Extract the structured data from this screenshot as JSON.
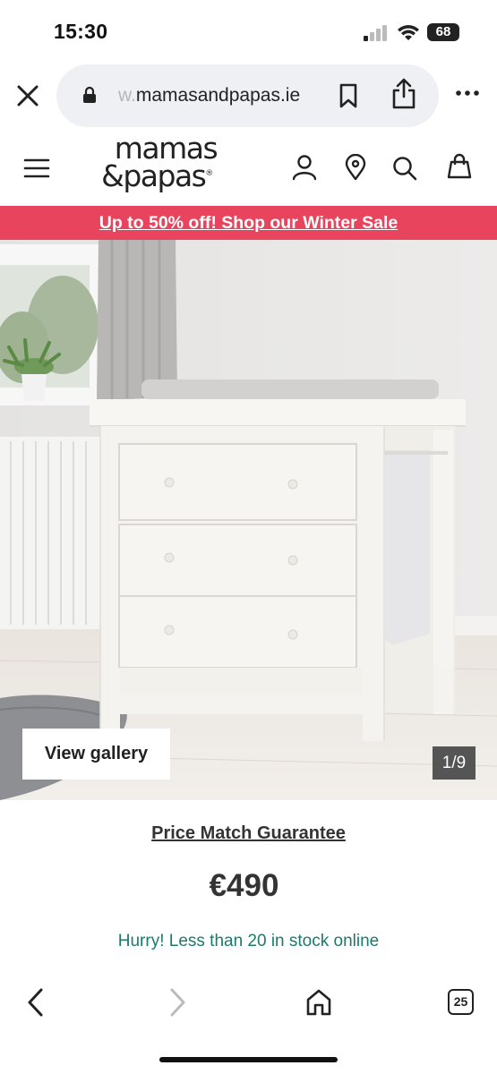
{
  "status_bar": {
    "time": "15:30",
    "battery": "68"
  },
  "browser": {
    "url_faded": "w.",
    "url": "mamasandpapas.ie",
    "tab_count": "25"
  },
  "site": {
    "logo_line1": "mamas",
    "logo_line2": "&papas",
    "logo_mark": "®",
    "promo_text": "Up to 50% off! Shop our Winter Sale"
  },
  "product": {
    "view_gallery_label": "View gallery",
    "image_counter": "1/9",
    "price_match_label": "Price Match Guarantee",
    "price": "€490",
    "stock_message": "Hurry! Less than 20 in stock online"
  },
  "colors": {
    "promo_bg": "#e8445d",
    "stock_text": "#1b7a6c",
    "url_bar_bg": "#eef0f3"
  }
}
